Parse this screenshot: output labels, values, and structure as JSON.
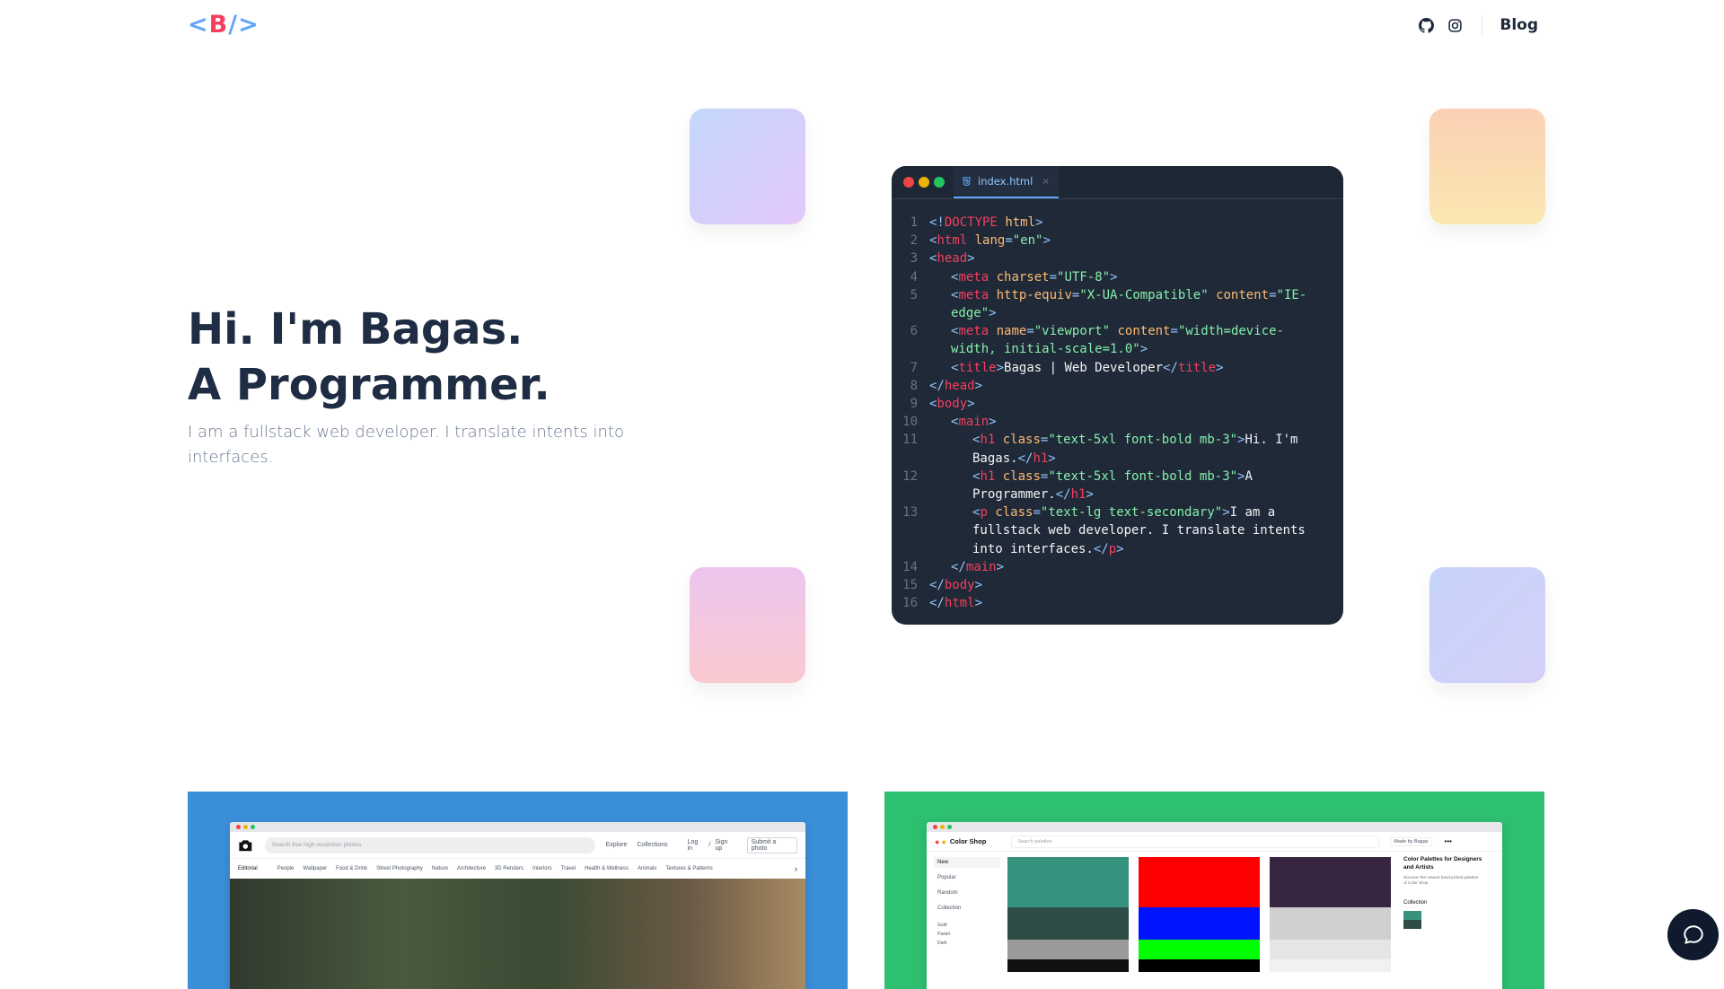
{
  "header": {
    "logo": {
      "lt": "<",
      "b": "B",
      "slash": "/>"
    },
    "nav": {
      "github_icon": "github-icon",
      "instagram_icon": "instagram-icon",
      "blog": "Blog"
    }
  },
  "hero": {
    "title_line1": "Hi. I'm Bagas.",
    "title_line2": "A Programmer.",
    "subtitle": "I am a fullstack web developer. I translate intents into interfaces."
  },
  "editor": {
    "tab_label": "index.html",
    "tab_close": "×",
    "line_numbers": [
      "1",
      "2",
      "3",
      "4",
      "5",
      "6",
      "7",
      "8",
      "9",
      "10",
      "11",
      "12",
      "13",
      "14",
      "15",
      "16"
    ],
    "dot_colors": [
      "#ef4444",
      "#eab308",
      "#22c55e"
    ]
  },
  "projects": [
    {
      "name": "unsplash-clone",
      "search_placeholder": "Search free high-resolution photos",
      "nav": [
        "Explore",
        "Collections",
        "Log in",
        "/",
        "Sign up",
        "Submit a photo"
      ],
      "categories": [
        "Editorial",
        "People",
        "Wallpaper",
        "Food & Drink",
        "Street Photography",
        "Nature",
        "Architecture",
        "3D Renders",
        "Interiors",
        "Travel",
        "Health & Wellness",
        "Animals",
        "Textures & Patterns"
      ]
    },
    {
      "name": "color-shop",
      "brand": "Color Shop",
      "search_placeholder": "Search palettes",
      "made_by": "Made by Bagas",
      "menu": [
        "New",
        "Popular",
        "Random",
        "Collection"
      ],
      "tags": [
        "Gold",
        "Pastel",
        "Dark"
      ],
      "side_title": "Color Palettes for Designers and Artists",
      "side_desc": "Discover the newest hand-picked palettes of Color Shop",
      "side_collection": "Collection"
    }
  ],
  "chat": {
    "icon": "chat-bubble-icon"
  },
  "colors": {
    "accent_blue": "#3b8fd9",
    "accent_green": "#2ec071",
    "heading": "#1e2d44"
  }
}
